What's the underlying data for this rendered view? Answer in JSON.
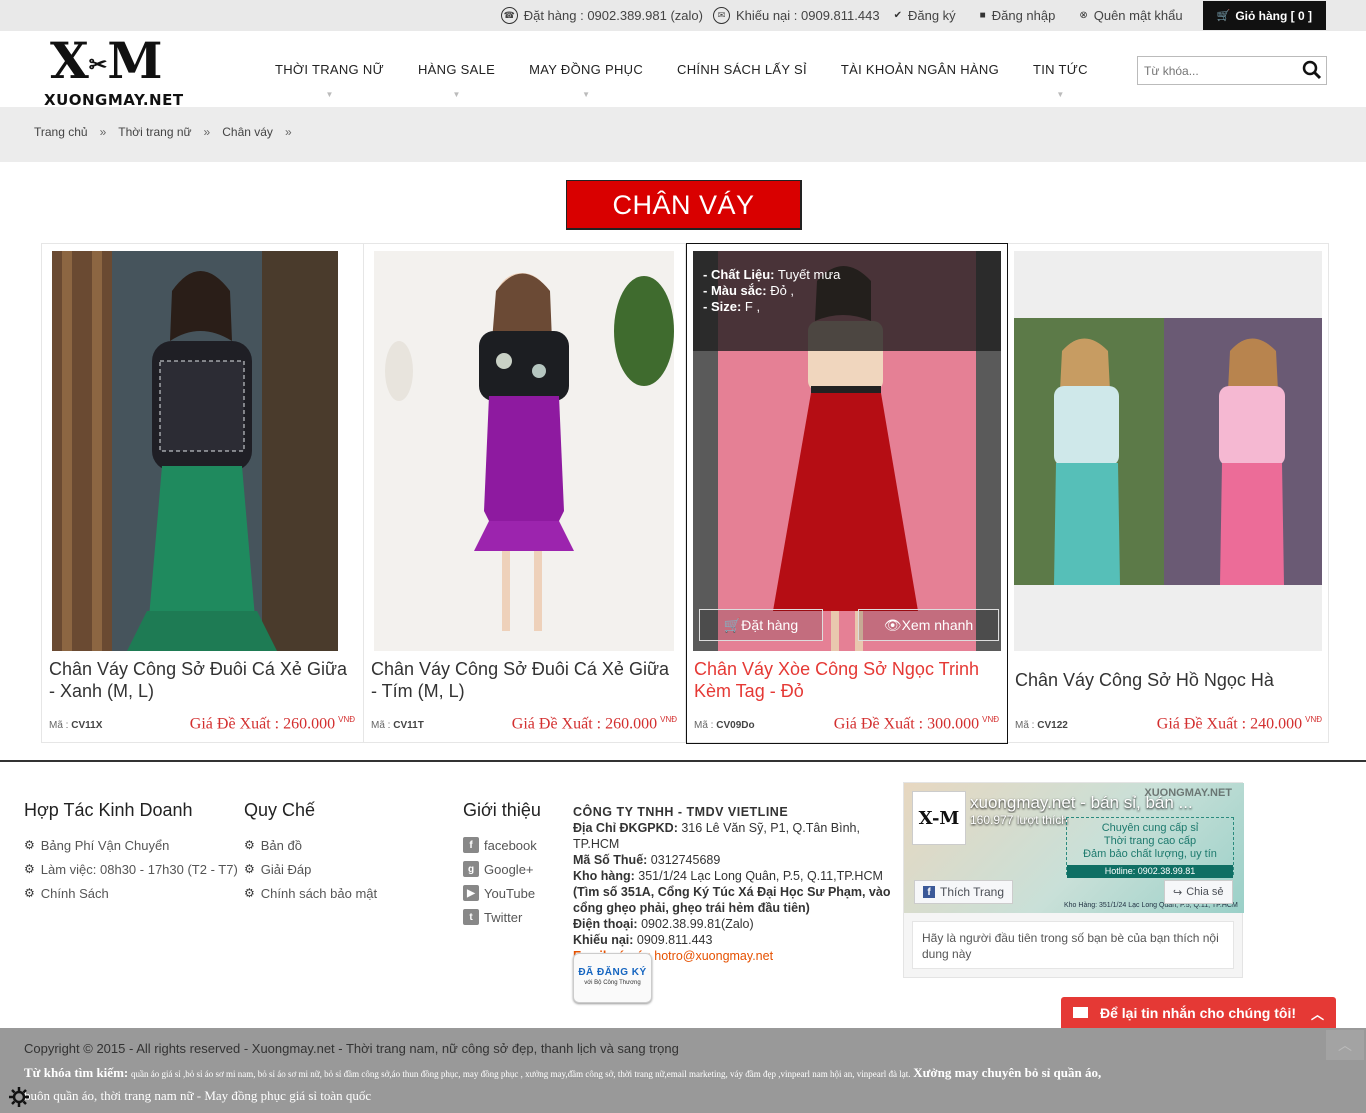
{
  "topbar": {
    "order_phone": "Đặt hàng : 0902.389.981 (zalo)",
    "complaint_phone": "Khiếu nại : 0909.811.443",
    "register": "Đăng ký",
    "login": "Đăng nhập",
    "forgot": "Quên mật khẩu",
    "cart": "Giỏ hàng [ 0 ]"
  },
  "logo": {
    "mark_left": "X",
    "mark_right": "M",
    "text": "XUONGMAY.NET"
  },
  "nav": [
    {
      "label": "THỜI TRANG NỮ",
      "has_sub": true
    },
    {
      "label": "HÀNG SALE",
      "has_sub": true
    },
    {
      "label": "MAY ĐỒNG PHỤC",
      "has_sub": true
    },
    {
      "label": "CHÍNH SÁCH LẤY SỈ",
      "has_sub": false
    },
    {
      "label": "TÀI KHOẢN NGÂN HÀNG",
      "has_sub": false
    },
    {
      "label": "TIN TỨC",
      "has_sub": true
    }
  ],
  "search": {
    "placeholder": "Từ khóa..."
  },
  "breadcrumb": [
    "Trang chủ",
    "Thời trang nữ",
    "Chân váy"
  ],
  "breadcrumb_sep": "»",
  "page_title": "CHÂN VÁY",
  "products": [
    {
      "name": "Chân Váy Công Sở Đuôi Cá Xẻ Giữa - Xanh (M, L)",
      "code_label": "Mã :",
      "code": "CV11X",
      "price": "Giá Đề Xuất : 260.000",
      "currency": "VNĐ"
    },
    {
      "name": "Chân Váy Công Sở Đuôi Cá Xẻ Giữa - Tím (M, L)",
      "code_label": "Mã :",
      "code": "CV11T",
      "price": "Giá Đề Xuất : 260.000",
      "currency": "VNĐ"
    },
    {
      "name": "Chân Váy Xòe Công Sở Ngọc Trinh Kèm Tag - Đỏ",
      "code_label": "Mã :",
      "code": "CV09Do",
      "price": "Giá Đề Xuất : 300.000",
      "currency": "VNĐ",
      "overlay": {
        "material_label": "- Chất Liệu:",
        "material": "Tuyết mưa",
        "color_label": "- Màu sắc:",
        "color": "Đỏ ,",
        "size_label": "- Size:",
        "size": "F ,"
      },
      "order_btn": "Đặt hàng",
      "quickview_btn": "Xem nhanh"
    },
    {
      "name": "Chân Váy Công Sở Hồ Ngọc Hà",
      "code_label": "Mã :",
      "code": "CV122",
      "price": "Giá Đề Xuất : 240.000",
      "currency": "VNĐ"
    }
  ],
  "footer": {
    "col1": {
      "title": "Hợp Tác Kinh Doanh",
      "items": [
        "Bảng Phí Vận Chuyển",
        "Làm việc: 08h30 - 17h30 (T2 - T7)",
        "Chính Sách"
      ]
    },
    "col2": {
      "title": "Quy Chế",
      "items": [
        "Bản đồ",
        "Giải Đáp",
        "Chính sách bảo mật"
      ]
    },
    "col3": {
      "title": "Giới thiệu",
      "items": [
        "facebook",
        "Google+",
        "YouTube",
        "Twitter"
      ]
    },
    "company": {
      "name": "CÔNG TY TNHH - TMDV VIETLINE",
      "addr_label": "Địa Chỉ ĐKGPKD:",
      "addr": "316 Lê Văn Sỹ, P1, Q.Tân Bình, TP.HCM",
      "tax_label": "Mã Số Thuế:",
      "tax": "0312745689",
      "warehouse_label": "Kho hàng:",
      "warehouse": "351/1/24 Lạc Long Quân, P.5, Q.11,TP.HCM",
      "directions": "(Tìm số 351A, Cổng Ký Túc Xá Đại Học Sư Phạm, vào cổng ghẹo phải, ghẹo trái hẻm đầu tiên)",
      "phone_label": "Điện thoại:",
      "phone": "0902.38.99.81(Zalo)",
      "complaint_label": "Khiếu nại:",
      "complaint": "0909.811.443",
      "email_label": "Email góp ý :",
      "email": "hotro@xuongmay.net",
      "badge_line1": "ĐÃ ĐĂNG KÝ",
      "badge_line2": "với Bộ Công Thương"
    },
    "facebook": {
      "page_name": "xuongmay.net - bán sỉ, bán ...",
      "likes": "160.977 lượt thích",
      "logo": "X-M",
      "watermark": "XUONGMAY.NET",
      "ad_line1": "Chuyên cung cấp sỉ",
      "ad_line2": "Thời trang cao cấp",
      "ad_line3": "Đảm bảo chất lượng, uy tín",
      "hotline": "Hotline: 0902.38.99.81",
      "address": "Kho Hàng: 351/1/24 Lạc Long Quân, P.5, Q.11, TP.HCM",
      "like_btn": "Thích Trang",
      "share_btn": "Chia sẻ",
      "message": "Hãy là người đầu tiên trong số bạn bè của bạn thích nội dung này"
    },
    "chat": "Để lại tin nhắn cho chúng tôi!",
    "copyright": "Copyright © 2015 - All rights reserved - Xuongmay.net - Thời trang nam, nữ công sở đẹp, thanh lịch và sang trọng",
    "keywords_label": "Từ khóa tìm kiếm:",
    "keywords": "quần áo giá sỉ ,bỏ sỉ áo sơ mi nam, bỏ sỉ áo sơ mi nữ, bỏ sỉ đầm công sở,áo thun đồng phục, may đồng phục , xưởng may,đầm công sở, thời trang nữ,email marketing, váy đầm đẹp ,vinpearl nam hội an, vinpearl đà lạt.",
    "keywords_tail": "Xưởng may chuyên bỏ sỉ quần áo,",
    "keywords_line2": "buôn quần áo, thời trang nam nữ - May đồng phục giá sỉ toàn quốc"
  },
  "colors": {
    "accent_red": "#d90000",
    "price_red": "#d32f2f",
    "chat_red": "#e53935"
  }
}
